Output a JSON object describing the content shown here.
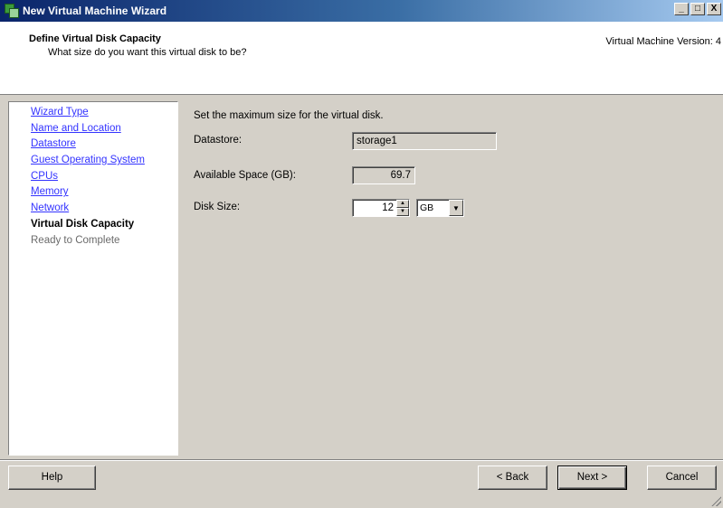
{
  "window": {
    "title": "New Virtual Machine Wizard",
    "controls": {
      "minimize": "_",
      "maximize": "□",
      "close": "X"
    }
  },
  "header": {
    "title": "Define Virtual Disk Capacity",
    "subtitle": "What size do you want this virtual disk to be?",
    "version": "Virtual Machine Version: 4"
  },
  "nav": {
    "items": [
      {
        "label": "Wizard Type",
        "state": "link"
      },
      {
        "label": "Name and Location",
        "state": "link"
      },
      {
        "label": "Datastore",
        "state": "link"
      },
      {
        "label": "Guest Operating System",
        "state": "link"
      },
      {
        "label": "CPUs",
        "state": "link"
      },
      {
        "label": "Memory",
        "state": "link"
      },
      {
        "label": "Network",
        "state": "link"
      },
      {
        "label": "Virtual Disk Capacity",
        "state": "current"
      },
      {
        "label": "Ready to Complete",
        "state": "pending"
      }
    ]
  },
  "form": {
    "instruction": "Set the maximum size for the virtual disk.",
    "datastore_label": "Datastore:",
    "datastore_value": "storage1",
    "available_label": "Available Space (GB):",
    "available_value": "69.7",
    "disk_size_label": "Disk Size:",
    "disk_size_value": "12",
    "disk_unit": "GB"
  },
  "buttons": {
    "help": "Help",
    "back": "< Back",
    "next": "Next >",
    "cancel": "Cancel"
  },
  "colors": {
    "link": "#3333ff",
    "title_gradient_start": "#0a246a",
    "title_gradient_end": "#a6caf0"
  }
}
